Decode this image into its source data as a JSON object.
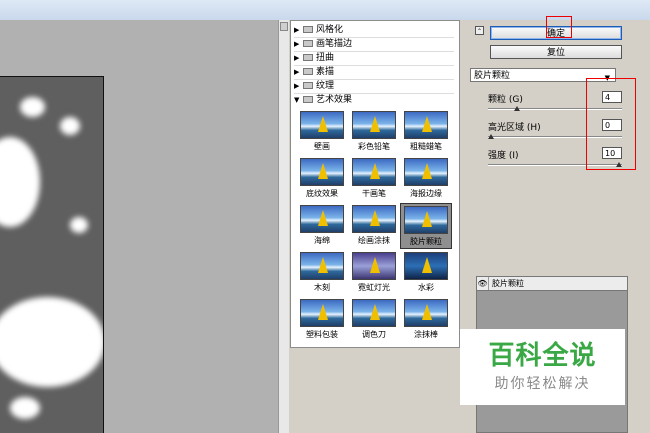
{
  "dialog": {
    "ok_label": "确定",
    "reset_label": "复位",
    "filter_select": "胶片颗粒",
    "collapse_glyph": "⌃"
  },
  "categories": [
    {
      "label": "风格化",
      "expanded": false
    },
    {
      "label": "画笔描边",
      "expanded": false
    },
    {
      "label": "扭曲",
      "expanded": false
    },
    {
      "label": "素描",
      "expanded": false
    },
    {
      "label": "纹理",
      "expanded": false
    },
    {
      "label": "艺术效果",
      "expanded": true
    }
  ],
  "thumbnails": [
    "壁画",
    "彩色铅笔",
    "粗糙蜡笔",
    "底纹效果",
    "干画笔",
    "海报边缘",
    "海绵",
    "绘画涂抹",
    "胶片颗粒",
    "木刻",
    "霓虹灯光",
    "水彩",
    "塑料包装",
    "调色刀",
    "涂抹棒"
  ],
  "selected_thumbnail": "胶片颗粒",
  "params": [
    {
      "label": "颗粒 (G)",
      "value": "4",
      "fraction": 0.2
    },
    {
      "label": "高光区域 (H)",
      "value": "0",
      "fraction": 0.0
    },
    {
      "label": "强度 (I)",
      "value": "10",
      "fraction": 1.0
    }
  ],
  "layer": {
    "name": "胶片颗粒",
    "eye": "👁"
  },
  "watermark": {
    "title": "百科全说",
    "subtitle": "助你轻松解决"
  },
  "colors": {
    "highlight_box": "#e00000",
    "logo_green": "#39a845"
  }
}
